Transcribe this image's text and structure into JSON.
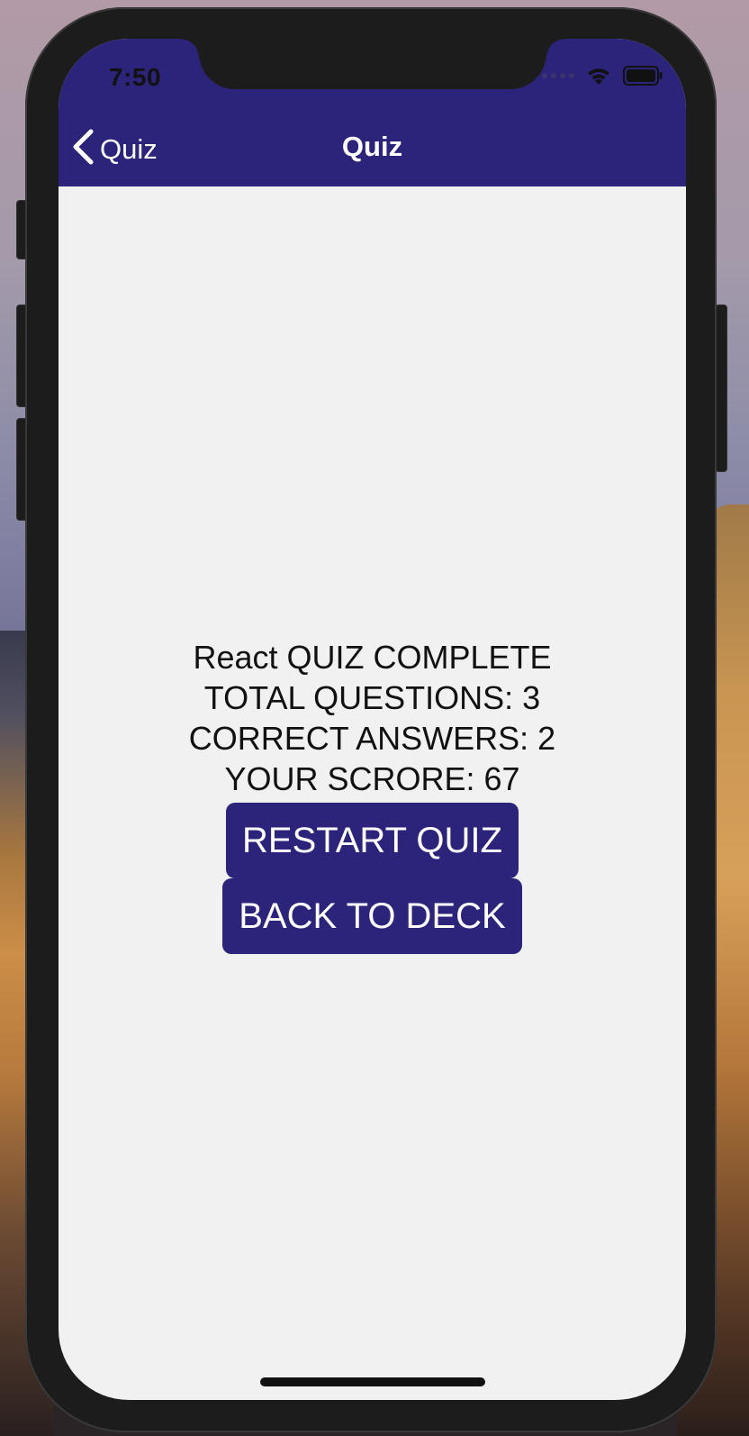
{
  "status_bar": {
    "time": "7:50",
    "icons": [
      "signal-dots-icon",
      "wifi-icon",
      "battery-icon"
    ]
  },
  "nav_bar": {
    "back_label": "Quiz",
    "back_icon": "chevron-left-icon",
    "title": "Quiz"
  },
  "result": {
    "heading": "React QUIZ COMPLETE",
    "total_questions": "TOTAL QUESTIONS: 3",
    "correct_answers": "CORRECT ANSWERS: 2",
    "score": "YOUR SCRORE: 67"
  },
  "actions": {
    "restart_label": "RESTART QUIZ",
    "back_to_deck_label": "BACK TO DECK"
  },
  "colors": {
    "accent": "#2b247a",
    "background": "#f1f1f1",
    "text": "#111111"
  }
}
